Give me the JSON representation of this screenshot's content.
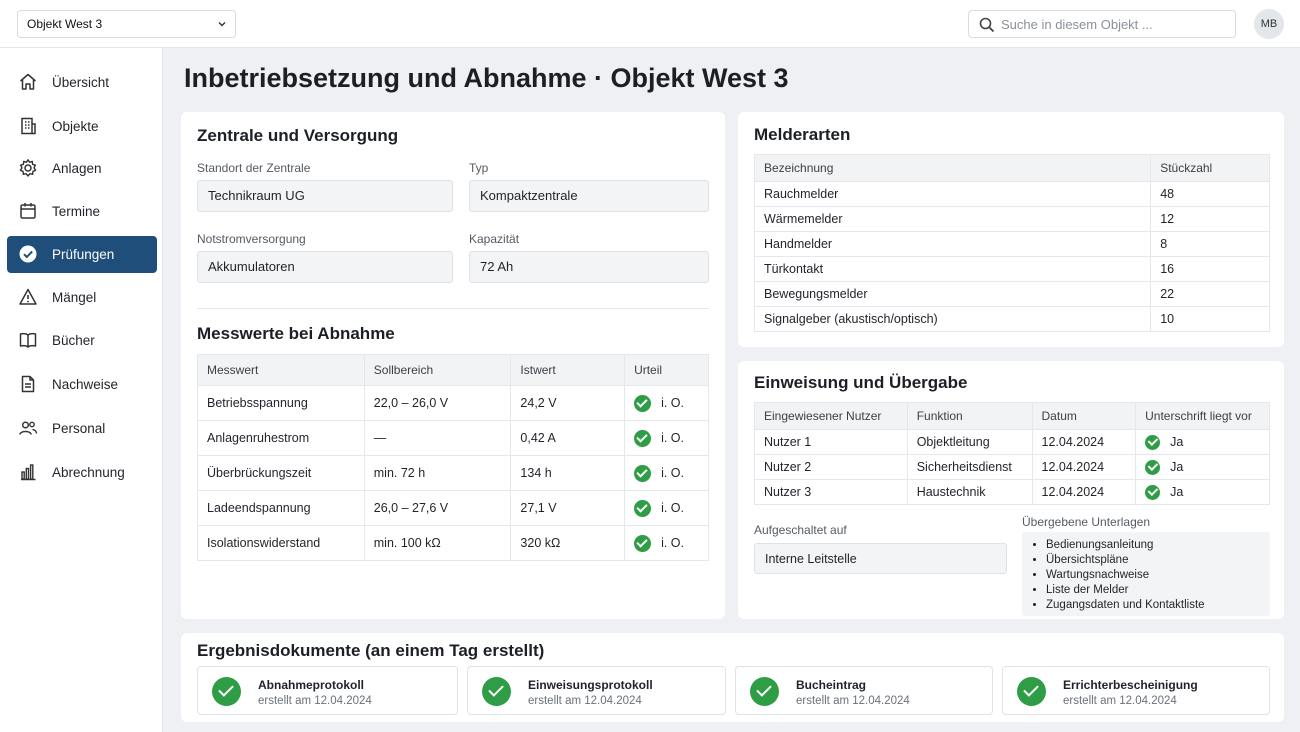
{
  "topbar": {
    "object_select": "Objekt West 3",
    "search_placeholder": "Suche in diesem Objekt ...",
    "avatar": "MB"
  },
  "sidebar": {
    "items": [
      {
        "label": "Übersicht",
        "icon": "home-icon"
      },
      {
        "label": "Objekte",
        "icon": "building-icon"
      },
      {
        "label": "Anlagen",
        "icon": "gear-icon"
      },
      {
        "label": "Termine",
        "icon": "calendar-icon"
      },
      {
        "label": "Prüfungen",
        "icon": "check-circle-icon",
        "active": true
      },
      {
        "label": "Mängel",
        "icon": "warning-icon"
      },
      {
        "label": "Bücher",
        "icon": "book-icon"
      },
      {
        "label": "Nachweise",
        "icon": "document-icon"
      },
      {
        "label": "Personal",
        "icon": "people-icon"
      },
      {
        "label": "Abrechnung",
        "icon": "bar-chart-icon"
      }
    ]
  },
  "page_title": "Inbetriebsetzung und Abnahme · Objekt West 3",
  "zentrale": {
    "title": "Zentrale und Versorgung",
    "standort_label": "Standort der Zentrale",
    "standort_value": "Technikraum UG",
    "typ_label": "Typ",
    "typ_value": "Kompaktzentrale",
    "notstrom_label": "Notstromversorgung",
    "notstrom_value": "Akkumulatoren",
    "kapazitaet_label": "Kapazität",
    "kapazitaet_value": "72 Ah"
  },
  "messwerte": {
    "title": "Messwerte bei Abnahme",
    "headers": [
      "Messwert",
      "Sollbereich",
      "Istwert",
      "Urteil"
    ],
    "rows": [
      {
        "name": "Betriebsspannung",
        "soll": "22,0 – 26,0 V",
        "ist": "24,2 V",
        "urteil": "i. O."
      },
      {
        "name": "Anlagenruhestrom",
        "soll": "—",
        "ist": "0,42 A",
        "urteil": "i. O."
      },
      {
        "name": "Überbrückungszeit",
        "soll": "min. 72 h",
        "ist": "134 h",
        "urteil": "i. O."
      },
      {
        "name": "Ladeendspannung",
        "soll": "26,0 – 27,6 V",
        "ist": "27,1 V",
        "urteil": "i. O."
      },
      {
        "name": "Isolationswiderstand",
        "soll": "min. 100 kΩ",
        "ist": "320 kΩ",
        "urteil": "i. O."
      }
    ]
  },
  "melderarten": {
    "title": "Melderarten",
    "headers": [
      "Bezeichnung",
      "Stückzahl"
    ],
    "rows": [
      {
        "name": "Rauchmelder",
        "count": "48"
      },
      {
        "name": "Wärmemelder",
        "count": "12"
      },
      {
        "name": "Handmelder",
        "count": "8"
      },
      {
        "name": "Türkontakt",
        "count": "16"
      },
      {
        "name": "Bewegungsmelder",
        "count": "22"
      },
      {
        "name": "Signalgeber (akustisch/optisch)",
        "count": "10"
      }
    ]
  },
  "einweisung": {
    "title": "Einweisung und Übergabe",
    "headers": [
      "Eingewiesener Nutzer",
      "Funktion",
      "Datum",
      "Unterschrift liegt vor"
    ],
    "rows": [
      {
        "user": "Nutzer 1",
        "funktion": "Objektleitung",
        "datum": "12.04.2024",
        "sig": "Ja"
      },
      {
        "user": "Nutzer 2",
        "funktion": "Sicherheitsdienst",
        "datum": "12.04.2024",
        "sig": "Ja"
      },
      {
        "user": "Nutzer 3",
        "funktion": "Haustechnik",
        "datum": "12.04.2024",
        "sig": "Ja"
      }
    ],
    "aufgeschaltet_label": "Aufgeschaltet auf",
    "aufgeschaltet_value": "Interne Leitstelle",
    "unterlagen_label": "Übergebene Unterlagen",
    "unterlagen": [
      "Bedienungsanleitung",
      "Übersichtspläne",
      "Wartungsnachweise",
      "Liste der Melder",
      "Zugangsdaten und Kontaktliste"
    ]
  },
  "ergebnis": {
    "title": "Ergebnisdokumente (an einem Tag erstellt)",
    "docs": [
      {
        "name": "Abnahmeprotokoll",
        "sub": "erstellt am 12.04.2024"
      },
      {
        "name": "Einweisungsprotokoll",
        "sub": "erstellt am 12.04.2024"
      },
      {
        "name": "Bucheintrag",
        "sub": "erstellt am 12.04.2024"
      },
      {
        "name": "Errichterbescheinigung",
        "sub": "erstellt am 12.04.2024"
      }
    ]
  },
  "colors": {
    "accent": "#1e4e79",
    "success": "#2e9d45"
  }
}
